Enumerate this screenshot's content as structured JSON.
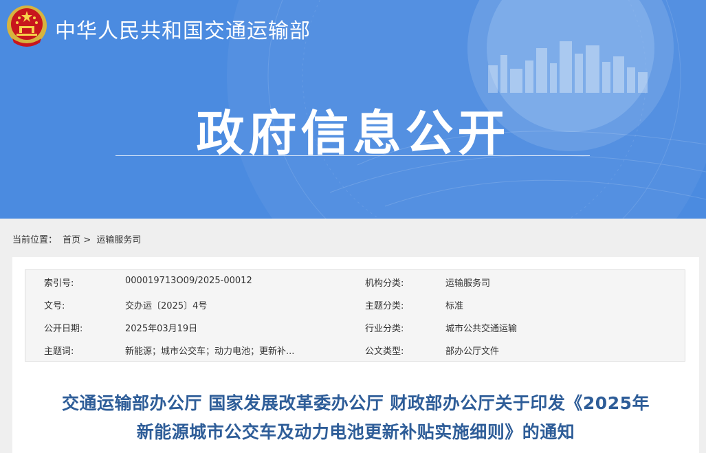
{
  "header": {
    "ministry_name": "中华人民共和国交通运输部",
    "section_title": "政府信息公开",
    "emblem_icon": "national-emblem-icon",
    "colors": {
      "banner_bg": "#4b8be0",
      "title_color": "#2e5d98"
    }
  },
  "breadcrumb": {
    "label": "当前位置：",
    "home": "首页",
    "separator": ">",
    "current": "运输服务司"
  },
  "meta": {
    "rows": [
      {
        "k1": "索引号:",
        "v1": "000019713O09/2025-00012",
        "k2": "机构分类:",
        "v2": "运输服务司"
      },
      {
        "k1": "文号:",
        "v1": "交办运〔2025〕4号",
        "k2": "主题分类:",
        "v2": "标准"
      },
      {
        "k1": "公开日期:",
        "v1": "2025年03月19日",
        "k2": "行业分类:",
        "v2": "城市公共交通运输"
      },
      {
        "k1": "主题词:",
        "v1": "新能源；城市公交车；动力电池；更新补...",
        "k2": "公文类型:",
        "v2": "部办公厅文件"
      }
    ]
  },
  "document": {
    "title_line1": "交通运输部办公厅 国家发展改革委办公厅 财政部办公厅关于印发《2025年",
    "title_line2": "新能源城市公交车及动力电池更新补贴实施细则》的通知"
  }
}
